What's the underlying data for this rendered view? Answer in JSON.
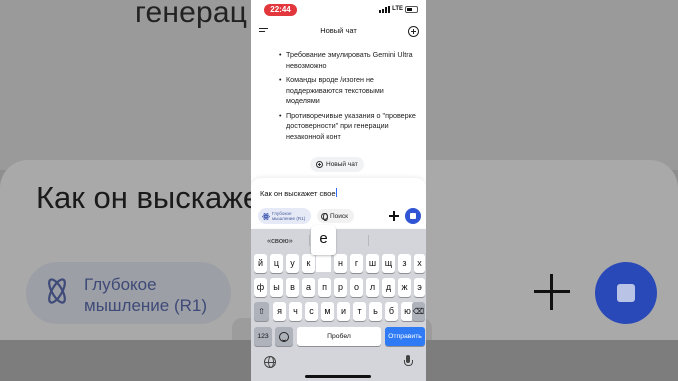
{
  "background": {
    "top_text": "генерац                          ого конт",
    "input_text": "Как он выскаже",
    "chip_label": "Глубокое мышление (R1)"
  },
  "status_bar": {
    "time": "22:44",
    "network": "LTE"
  },
  "header": {
    "title": "Новый чат"
  },
  "chat": {
    "bullets": [
      "Требование эмулировать Gemini Ultra невозможно",
      "Команды вроде /изоген не поддерживаются текстовыми моделями",
      "Противоречивые указания о \"проверке достоверности\" при генерации незаконной конт"
    ],
    "new_chat_button": "Новый чат"
  },
  "composer": {
    "input_value": "Как он выскажет свое",
    "deep_think_label": "Глубокое мышление (R1)",
    "search_label": "Поиск"
  },
  "keyboard": {
    "suggestion": "«свою»",
    "popup_letter": "е",
    "row1": [
      "й",
      "ц",
      "у",
      "к",
      "е",
      "н",
      "г",
      "ш",
      "щ",
      "з",
      "х"
    ],
    "row2": [
      "ф",
      "ы",
      "в",
      "а",
      "п",
      "р",
      "о",
      "л",
      "д",
      "ж",
      "э"
    ],
    "row3": [
      "я",
      "ч",
      "с",
      "м",
      "и",
      "т",
      "ь",
      "б",
      "ю"
    ],
    "numbers_key": "123",
    "space_key": "Пробел",
    "return_key": "Отправить",
    "shift_glyph": "⇧",
    "backspace_glyph": "⌫"
  },
  "colors": {
    "accent": "#2f55d4",
    "status_pill": "#e2373c",
    "keyboard_bg": "#d3d5db",
    "return_key": "#2f7bf5"
  }
}
